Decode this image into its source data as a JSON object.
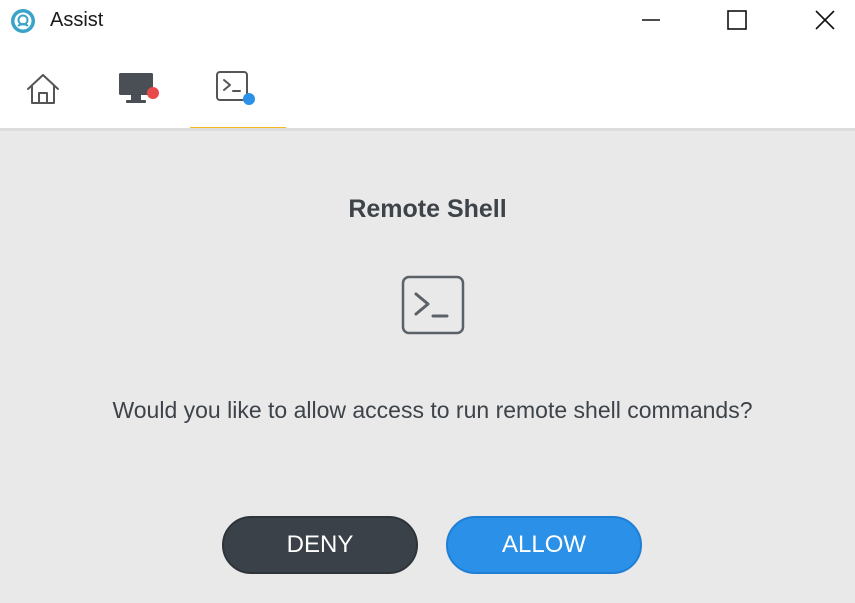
{
  "window": {
    "title": "Assist",
    "controls": {
      "minimize": "minimize-icon",
      "maximize": "maximize-icon",
      "close": "close-icon"
    }
  },
  "toolbar": {
    "tabs": [
      {
        "id": "home",
        "icon": "home-icon",
        "active": false
      },
      {
        "id": "screen",
        "icon": "monitor-icon",
        "badge_color": "#e84a4a",
        "active": false
      },
      {
        "id": "shell",
        "icon": "terminal-icon",
        "badge_color": "#2b90e8",
        "active": true
      }
    ],
    "active_underline_color": "#f5b823"
  },
  "dialog": {
    "title": "Remote Shell",
    "icon": "terminal-icon",
    "message": "Would you like to allow access to run remote shell commands?",
    "deny_label": "DENY",
    "allow_label": "ALLOW"
  },
  "colors": {
    "content_bg": "#e9e9e9",
    "deny_bg": "#3a4148",
    "allow_bg": "#2b90e8",
    "text": "#3d4349"
  }
}
